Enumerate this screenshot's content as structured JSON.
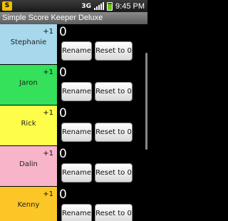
{
  "status_bar": {
    "time": "9:45 PM",
    "network": "3G",
    "app_icon_glyph": "S"
  },
  "title_bar": {
    "title": "Simple Score Keeper Deluxe"
  },
  "players": [
    {
      "name": "Stephanie",
      "score": "0",
      "increment_label": "+1",
      "color": "#a7d8ec",
      "rename_label": "Rename",
      "reset_label": "Reset to 0"
    },
    {
      "name": "Jaron",
      "score": "0",
      "increment_label": "+1",
      "color": "#35e05a",
      "rename_label": "Rename",
      "reset_label": "Reset to 0"
    },
    {
      "name": "Rick",
      "score": "0",
      "increment_label": "+1",
      "color": "#fefe4a",
      "rename_label": "Rename",
      "reset_label": "Reset to 0"
    },
    {
      "name": "Dalin",
      "score": "0",
      "increment_label": "+1",
      "color": "#f8b4c8",
      "rename_label": "Rename",
      "reset_label": "Reset to 0"
    },
    {
      "name": "Kenny",
      "score": "0",
      "increment_label": "+1",
      "color": "#fcc726",
      "rename_label": "Rename",
      "reset_label": "Reset to 0"
    }
  ]
}
